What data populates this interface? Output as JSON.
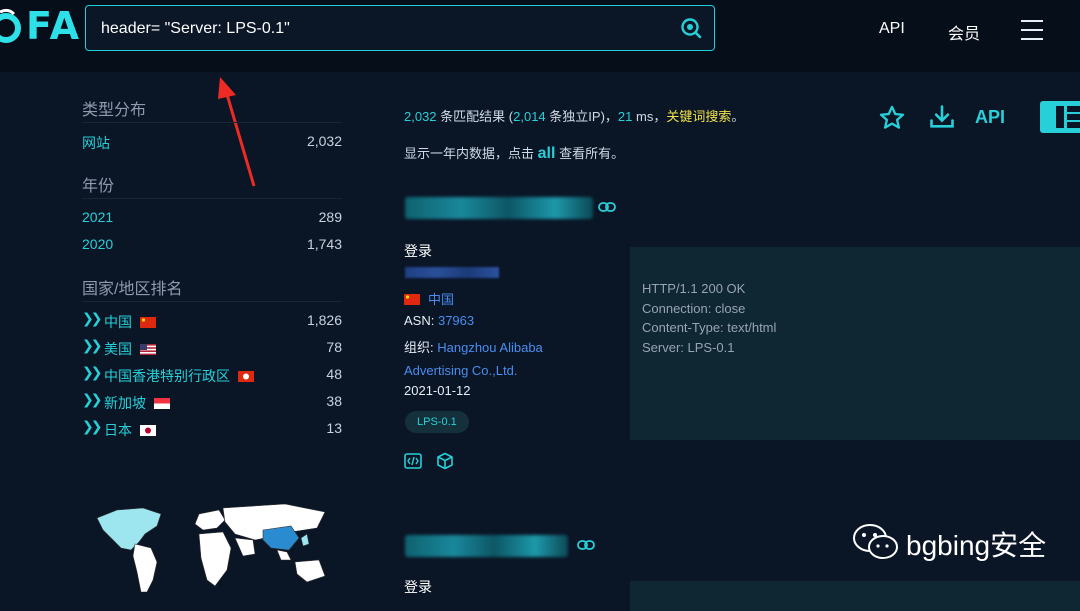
{
  "header": {
    "logo": "FA",
    "search_value": "header= \"Server: LPS-0.1\"",
    "nav_api": "API",
    "nav_member": "会员"
  },
  "sidebar": {
    "type_title": "类型分布",
    "types": [
      {
        "label": "网站",
        "count": "2,032"
      }
    ],
    "year_title": "年份",
    "years": [
      {
        "label": "2021",
        "count": "289"
      },
      {
        "label": "2020",
        "count": "1,743"
      }
    ],
    "country_title": "国家/地区排名",
    "countries": [
      {
        "label": "中国",
        "count": "1,826",
        "flag": "cn"
      },
      {
        "label": "美国",
        "count": "78",
        "flag": "us"
      },
      {
        "label": "中国香港特别行政区",
        "count": "48",
        "flag": "hk"
      },
      {
        "label": "新加坡",
        "count": "38",
        "flag": "sg"
      },
      {
        "label": "日本",
        "count": "13",
        "flag": "jp"
      }
    ]
  },
  "summary": {
    "total": "2,032",
    "matches_text": "条匹配结果 (",
    "unique": "2,014",
    "unique_text": "条独立IP)，",
    "ms": "21",
    "ms_text": "ms，",
    "keyword_search": "关键词搜索",
    "period": "。",
    "note_pre": "显示一年内数据，点击",
    "note_all": "all",
    "note_post": "查看所有。",
    "api": "API"
  },
  "result": {
    "title": "登录",
    "country": "中国",
    "asn_label": "ASN:",
    "asn": "37963",
    "org_label": "组织:",
    "org": "Hangzhou Alibaba Advertising Co.,Ltd.",
    "date": "2021-01-12",
    "tag": "LPS-0.1",
    "banner_lines": [
      "HTTP/1.1 200 OK",
      "Connection: close",
      "Content-Type: text/html",
      "Server: LPS-0.1"
    ]
  },
  "result2": {
    "title": "登录"
  },
  "watermark": {
    "text": "bgbing安全"
  },
  "colors": {
    "accent": "#27d0d8",
    "background": "#0a1525",
    "highlight": "#f1e34a",
    "link": "#4a8df0"
  }
}
